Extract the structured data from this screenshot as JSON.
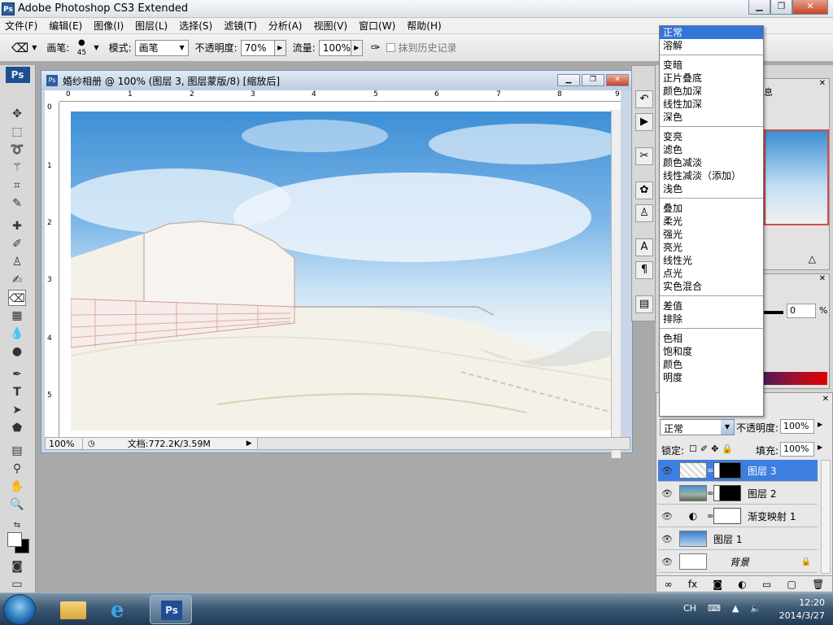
{
  "app": {
    "title": "Adobe Photoshop CS3 Extended",
    "logo": "Ps"
  },
  "menu": [
    "文件(F)",
    "编辑(E)",
    "图像(I)",
    "图层(L)",
    "选择(S)",
    "滤镜(T)",
    "分析(A)",
    "视图(V)",
    "窗口(W)",
    "帮助(H)"
  ],
  "options": {
    "brush_label": "画笔:",
    "brush_size": "45",
    "mode_label": "模式:",
    "mode_value": "画笔",
    "opacity_label": "不透明度:",
    "opacity_value": "70%",
    "flow_label": "流量:",
    "flow_value": "100%",
    "history_label": "抹到历史记录"
  },
  "document": {
    "title": "婚纱相册 @ 100% (图层 3, 图层蒙版/8) [缩放后]",
    "zoom": "100%",
    "doc_info": "文档:772.2K/3.59M",
    "ruler_h": [
      "0",
      "1",
      "2",
      "3",
      "4",
      "5",
      "6",
      "7",
      "8",
      "9"
    ],
    "ruler_v": [
      "0",
      "1",
      "2",
      "3",
      "4",
      "5"
    ]
  },
  "blend_modes": {
    "selected": "正常",
    "groups": [
      [
        "正常",
        "溶解"
      ],
      [
        "变暗",
        "正片叠底",
        "颜色加深",
        "线性加深",
        "深色"
      ],
      [
        "变亮",
        "滤色",
        "颜色减淡",
        "线性减淡（添加）",
        "浅色"
      ],
      [
        "叠加",
        "柔光",
        "强光",
        "亮光",
        "线性光",
        "点光",
        "实色混合"
      ],
      [
        "差值",
        "排除"
      ],
      [
        "色相",
        "饱和度",
        "颜色",
        "明度"
      ]
    ]
  },
  "color_panel": {
    "value": "0",
    "unit": "%"
  },
  "nav_panel": {
    "tab": "息"
  },
  "layers": {
    "mode": "正常",
    "opacity_label": "不透明度:",
    "opacity": "100%",
    "lock_label": "锁定:",
    "fill_label": "填充:",
    "fill": "100%",
    "items": [
      {
        "name": "图层 3",
        "selected": true
      },
      {
        "name": "图层 2",
        "selected": false
      },
      {
        "name": "渐变映射 1",
        "selected": false
      },
      {
        "name": "图层 1",
        "selected": false
      },
      {
        "name": "背景",
        "selected": false
      }
    ]
  },
  "taskbar": {
    "lang": "CH",
    "time": "12:20",
    "date": "2014/3/27"
  }
}
